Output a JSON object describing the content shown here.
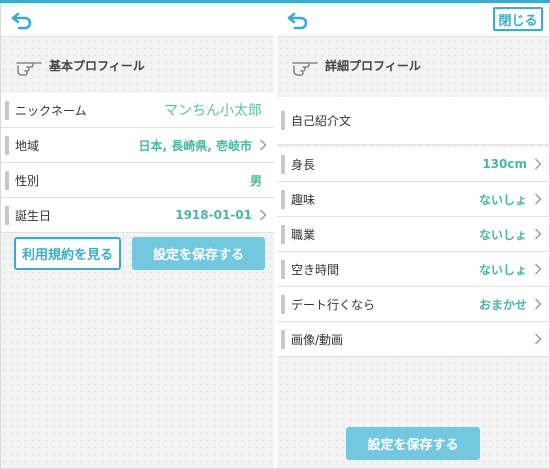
{
  "colors": {
    "accent": "#3aaec8",
    "value": "#49b8a3",
    "button_fill": "#73c7de"
  },
  "left_panel": {
    "section_title": "基本プロフィール",
    "rows": [
      {
        "label": "ニックネーム",
        "value": "マンちん小太郎"
      },
      {
        "label": "地域",
        "value": "日本, 長崎県, 壱岐市"
      },
      {
        "label": "性別",
        "value": "男"
      },
      {
        "label": "誕生日",
        "value": "1918-01-01"
      }
    ],
    "terms_button": "利用規約を見る",
    "save_button": "設定を保存する"
  },
  "right_panel": {
    "close_button": "閉じる",
    "section_title": "詳細プロフィール",
    "intro_label": "自己紹介文",
    "rows": [
      {
        "label": "身長",
        "value": "130cm"
      },
      {
        "label": "趣味",
        "value": "ないしょ"
      },
      {
        "label": "職業",
        "value": "ないしょ"
      },
      {
        "label": "空き時間",
        "value": "ないしょ"
      },
      {
        "label": "デート行くなら",
        "value": "おまかせ"
      },
      {
        "label": "画像/動画",
        "value": ""
      }
    ],
    "save_button": "設定を保存する"
  },
  "icons": {
    "back": "back-arrow-icon",
    "hand": "pointing-hand-icon",
    "chevron": "chevron-right-icon"
  }
}
